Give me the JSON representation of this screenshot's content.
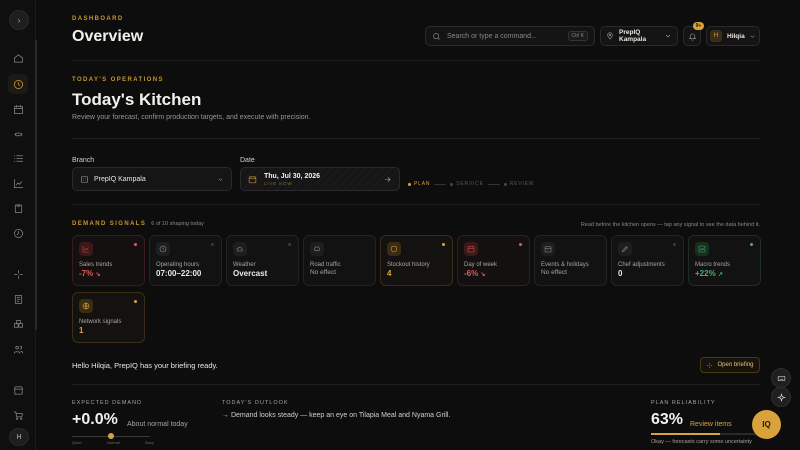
{
  "sidebar": {
    "toggle_glyph": "›",
    "user_initial": "H",
    "icons": [
      "home-icon",
      "clock-icon",
      "calendar-icon",
      "chef-hat-icon",
      "list-icon",
      "chart-icon",
      "clipboard-icon",
      "history-icon",
      "sparkle-icon",
      "receipt-icon",
      "boxes-icon",
      "users-icon",
      "store-icon",
      "cart-icon"
    ]
  },
  "header": {
    "eyebrow": "DASHBOARD",
    "title": "Overview",
    "search_placeholder": "Search or type a command...",
    "search_shortcut": "Ctrl K",
    "branch": "PrepIQ Kampala",
    "notification_count": "9+",
    "user_initial": "H",
    "user_name": "Hilqia"
  },
  "ops": {
    "eyebrow": "TODAY'S OPERATIONS",
    "title": "Today's Kitchen",
    "subtitle": "Review your forecast, confirm production targets, and execute with precision."
  },
  "controls": {
    "branch_label": "Branch",
    "branch_value": "PrepIQ Kampala",
    "date_label": "Date",
    "date_value": "Thu, Jul 30, 2026",
    "date_status": "LIVE NOW",
    "steps": [
      "PLAN",
      "SERVICE",
      "REVIEW"
    ]
  },
  "signals": {
    "title": "DEMAND SIGNALS",
    "count": "6 of 10 shaping today",
    "note": "Read before the kitchen opens — tap any signal to see the data behind it.",
    "cards": [
      {
        "name": "Sales trends",
        "value": "-7%",
        "arrow": "↘",
        "tone": "bad",
        "icon": "chart-icon"
      },
      {
        "name": "Operating hours",
        "value": "07:00–22:00",
        "arrow": "",
        "tone": "neutral",
        "icon": "clock-icon"
      },
      {
        "name": "Weather",
        "value": "Overcast",
        "arrow": "",
        "tone": "neutral",
        "icon": "cloud-icon"
      },
      {
        "name": "Road traffic",
        "value": "No effect",
        "arrow": "",
        "tone": "muted",
        "icon": "car-icon"
      },
      {
        "name": "Stockout history",
        "value": "4",
        "arrow": "",
        "tone": "warn",
        "icon": "shield-icon"
      },
      {
        "name": "Day of week",
        "value": "-6%",
        "arrow": "↘",
        "tone": "bad",
        "icon": "calendar-icon"
      },
      {
        "name": "Events & holidays",
        "value": "No effect",
        "arrow": "",
        "tone": "muted",
        "icon": "event-icon"
      },
      {
        "name": "Chef adjustments",
        "value": "0",
        "arrow": "",
        "tone": "neutral",
        "icon": "pen-icon"
      },
      {
        "name": "Macro trends",
        "value": "+22%",
        "arrow": "↗",
        "tone": "good",
        "icon": "trend-icon"
      },
      {
        "name": "Network signals",
        "value": "1",
        "arrow": "",
        "tone": "warn",
        "icon": "globe-icon"
      }
    ]
  },
  "briefing": {
    "text": "Hello Hilqia, PrepIQ has your briefing ready.",
    "button": "Open briefing"
  },
  "demand": {
    "label": "EXPECTED DEMAND",
    "value": "+0.0%",
    "sub": "About normal today",
    "ticks": [
      "Quiet",
      "Normal",
      "Busy"
    ],
    "level": 0.5
  },
  "outlook": {
    "label": "TODAY'S OUTLOOK",
    "text": "→ Demand looks steady — keep an eye on Tilapia Meal and Nyama Grill."
  },
  "reliability": {
    "label": "PLAN RELIABILITY",
    "value": "63%",
    "link": "Review items",
    "fill": 0.63,
    "note": "Okay — forecasts carry some uncertainty"
  },
  "fab": {
    "iq_label": "IQ"
  },
  "colors": {
    "accent": "#d8a33c",
    "bad": "#e35a5a",
    "good": "#4cb06a"
  }
}
